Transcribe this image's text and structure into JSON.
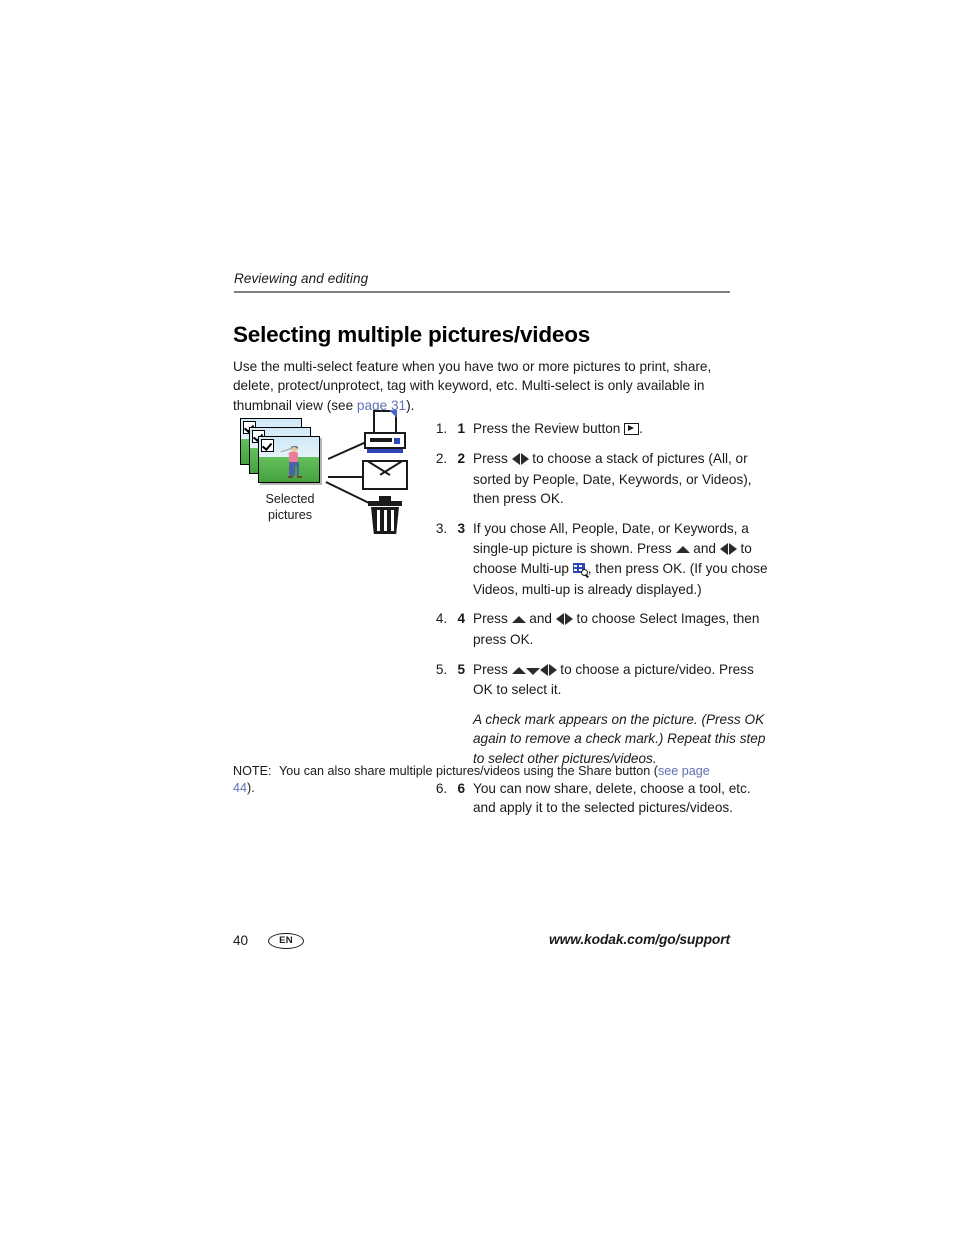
{
  "header": {
    "running_head": "Reviewing and editing"
  },
  "title": "Selecting multiple pictures/videos",
  "intro": {
    "text_before_link": "Use the multi-select feature when you have two or more pictures to print, share, delete, protect/unprotect, tag with keyword, etc. Multi-select is only available in thumbnail view (see ",
    "link_label": "page 31",
    "text_after_link": ")."
  },
  "figure": {
    "caption": "Selected pictures",
    "photo_count": 3,
    "photo_subject": "golfer swinging club",
    "destinations": [
      "printer-icon",
      "envelope-icon",
      "trash-icon"
    ],
    "checkmark_icon": "checkmark-icon"
  },
  "steps": [
    {
      "num": "1",
      "parts": [
        {
          "type": "text",
          "value": "Press the Review button "
        },
        {
          "type": "icon",
          "value": "review-button-icon"
        },
        {
          "type": "text",
          "value": "."
        }
      ]
    },
    {
      "num": "2",
      "parts": [
        {
          "type": "text",
          "value": "Press "
        },
        {
          "type": "icon",
          "value": "left-right-arrows-icon"
        },
        {
          "type": "text",
          "value": " to choose a stack of pictures (All, or sorted by People, Date, Keywords, or Videos), then press OK."
        }
      ]
    },
    {
      "num": "3",
      "parts": [
        {
          "type": "text",
          "value": "If you chose All, People, Date, or Keywords, a single-up picture is shown. Press "
        },
        {
          "type": "icon",
          "value": "up-arrow-icon"
        },
        {
          "type": "text",
          "value": " and "
        },
        {
          "type": "icon",
          "value": "left-right-arrows-icon"
        },
        {
          "type": "text",
          "value": " to choose Multi-up "
        },
        {
          "type": "icon",
          "value": "multi-up-icon"
        },
        {
          "type": "text",
          "value": ", then press OK. (If you chose Videos, multi-up is already displayed.)"
        }
      ]
    },
    {
      "num": "4",
      "parts": [
        {
          "type": "text",
          "value": "Press "
        },
        {
          "type": "icon",
          "value": "up-arrow-icon"
        },
        {
          "type": "text",
          "value": " and "
        },
        {
          "type": "icon",
          "value": "left-right-arrows-icon"
        },
        {
          "type": "text",
          "value": " to choose Select Images, then press OK."
        }
      ]
    },
    {
      "num": "5",
      "parts": [
        {
          "type": "text",
          "value": "Press "
        },
        {
          "type": "icon",
          "value": "up-down-arrows-icon"
        },
        {
          "type": "icon",
          "value": "left-right-arrows-icon"
        },
        {
          "type": "text",
          "value": " to choose a picture/video. Press OK to select it."
        }
      ],
      "note": "A check mark appears on the picture. (Press OK again to remove a check mark.) Repeat this step to select other pictures/videos."
    },
    {
      "num": "6",
      "parts": [
        {
          "type": "text",
          "value": "You can now share, delete, choose a tool, etc. and apply it to the selected pictures/videos."
        }
      ]
    }
  ],
  "note": {
    "label": "NOTE:",
    "text_before_link": "You can also share multiple pictures/videos using the Share button (",
    "link_label": "see page 44",
    "text_after_link": ")."
  },
  "footer": {
    "page_number": "40",
    "language_badge": "EN",
    "support_url": "www.kodak.com/go/support"
  },
  "colors": {
    "link": "#5f72b5",
    "rule": "#808080",
    "text": "#1a1a1a",
    "printer_accent": "#2f46b8",
    "grass": "#46a23f",
    "sky": "#cfe9f7",
    "shirt": "#e87f9a",
    "jeans": "#4a63a8"
  }
}
